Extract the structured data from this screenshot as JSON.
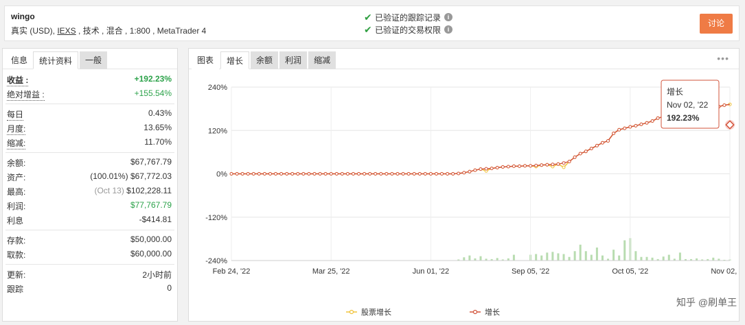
{
  "account": {
    "name": "wingo",
    "desc_prefix": "真实 (USD), ",
    "desc_link": "IEXS",
    "desc_suffix": " , 技术 , 混合 , 1:800 , MetaTrader 4"
  },
  "verify": [
    {
      "label": "已验证的跟踪记录"
    },
    {
      "label": "已验证的交易权限"
    }
  ],
  "discuss_label": "讨论",
  "left_tabs": [
    "信息",
    "统计资料",
    "一般"
  ],
  "stats_top": [
    {
      "label": "收益 :",
      "value": "+192.23%"
    },
    {
      "label": "绝对增益 :",
      "value": "+155.54%"
    }
  ],
  "stats_mid": [
    {
      "label": "每日",
      "value": "0.43%"
    },
    {
      "label": "月度:",
      "value": "13.65%"
    },
    {
      "label": "缩减:",
      "value": "11.70%"
    }
  ],
  "stats_balance": [
    {
      "label": "余额:",
      "value": "$67,767.79"
    },
    {
      "label": "资产:",
      "prefix": "(100.01%)",
      "value": "$67,772.03"
    },
    {
      "label": "最高:",
      "prefix": "(Oct 13)",
      "value": "$102,228.11"
    },
    {
      "label": "利润:",
      "value": "$77,767.79"
    },
    {
      "label": "利息",
      "value": "-$414.81"
    }
  ],
  "stats_cash": [
    {
      "label": "存款:",
      "value": "$50,000.00"
    },
    {
      "label": "取款:",
      "value": "$60,000.00"
    }
  ],
  "stats_bottom": [
    {
      "label": "更新:",
      "value": "2小时前"
    },
    {
      "label": "跟踪",
      "value": "0"
    }
  ],
  "right_tabs": [
    "图表",
    "增长",
    "余额",
    "利润",
    "缩减"
  ],
  "more_label": "•••",
  "tooltip": {
    "title": "增长",
    "date": "Nov 02, '22",
    "value": "192.23%"
  },
  "watermark": "知乎 @刷单王",
  "colors": {
    "growth": "#d2533a",
    "equity": "#f0c23a",
    "bars": "#b8dcb0",
    "accent": "#ef7b45"
  },
  "chart_data": {
    "type": "line",
    "yticks": [
      "240%",
      "120%",
      "0%",
      "-120%",
      "-240%"
    ],
    "ylim": [
      -240,
      240
    ],
    "xticks": [
      "Feb 24, '22",
      "Mar 25, '22",
      "Jun 01, '22",
      "Sep 05, '22",
      "Oct 05, '22",
      "Nov 02, '22"
    ],
    "legend": [
      "股票增长",
      "增长"
    ],
    "series": [
      {
        "name": "增长",
        "values": [
          0,
          0,
          0,
          0,
          0,
          0,
          0,
          0,
          0,
          0,
          0,
          0,
          0,
          0,
          0,
          0,
          0,
          0,
          0,
          0,
          0,
          0,
          0,
          0,
          0,
          0,
          0,
          0,
          0,
          0,
          0,
          0,
          0,
          0,
          0,
          0,
          0,
          0,
          0,
          0,
          0,
          1,
          3,
          6,
          10,
          13,
          14,
          15,
          17,
          19,
          20,
          21,
          21,
          22,
          22,
          23,
          24,
          25,
          26,
          27,
          30,
          34,
          46,
          56,
          62,
          70,
          78,
          86,
          91,
          112,
          122,
          126,
          130,
          133,
          137,
          141,
          146,
          154,
          158,
          160,
          163,
          165,
          167,
          169,
          171,
          173,
          176,
          180,
          186,
          190,
          192.23
        ]
      },
      {
        "name": "股票增长",
        "values": [
          0,
          0,
          0,
          0,
          0,
          0,
          0,
          0,
          0,
          0,
          0,
          0,
          0,
          0,
          0,
          0,
          0,
          0,
          0,
          0,
          0,
          0,
          0,
          0,
          0,
          0,
          0,
          0,
          0,
          0,
          0,
          0,
          0,
          0,
          0,
          0,
          0,
          0,
          0,
          0,
          0,
          1,
          3,
          6,
          10,
          13,
          8,
          15,
          17,
          19,
          20,
          21,
          21,
          22,
          22,
          20,
          24,
          25,
          20,
          27,
          18,
          34,
          46,
          56,
          62,
          70,
          78,
          86,
          91,
          112,
          122,
          126,
          130,
          133,
          137,
          141,
          146,
          154,
          158,
          160,
          163,
          165,
          167,
          169,
          171,
          173,
          176,
          180,
          186,
          190,
          192.23
        ]
      }
    ],
    "bars": [
      0,
      0,
      0,
      0,
      0,
      0,
      0,
      0,
      0,
      0,
      0,
      0,
      0,
      0,
      0,
      0,
      0,
      0,
      0,
      0,
      0,
      0,
      0,
      0,
      0,
      0,
      0,
      0,
      0,
      0,
      0,
      0,
      0,
      0,
      0,
      0,
      0,
      0,
      0,
      0,
      0,
      3,
      9,
      14,
      6,
      12,
      5,
      4,
      7,
      3,
      6,
      16,
      0,
      0,
      16,
      18,
      14,
      22,
      24,
      20,
      18,
      10,
      26,
      44,
      26,
      16,
      36,
      14,
      5,
      30,
      14,
      56,
      62,
      26,
      10,
      10,
      8,
      4,
      11,
      16,
      5,
      22,
      4,
      4,
      6,
      3,
      4,
      8,
      5,
      2,
      3
    ]
  }
}
